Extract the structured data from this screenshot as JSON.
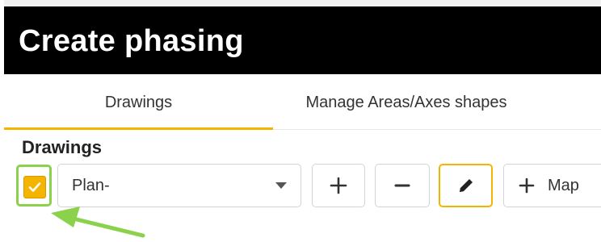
{
  "dialog": {
    "title": "Create phasing"
  },
  "tabs": [
    {
      "label": "Drawings",
      "active": true
    },
    {
      "label": "Manage Areas/Axes shapes",
      "active": false
    }
  ],
  "section": {
    "label": "Drawings"
  },
  "drawing_row": {
    "checkbox_checked": true,
    "select_value": "Plan-",
    "add_icon": "plus-icon",
    "remove_icon": "minus-icon",
    "edit_icon": "pencil-icon",
    "map_label": "Map"
  },
  "colors": {
    "accent": "#f5b400",
    "highlight": "#8cd14c",
    "titlebar": "#000000"
  }
}
